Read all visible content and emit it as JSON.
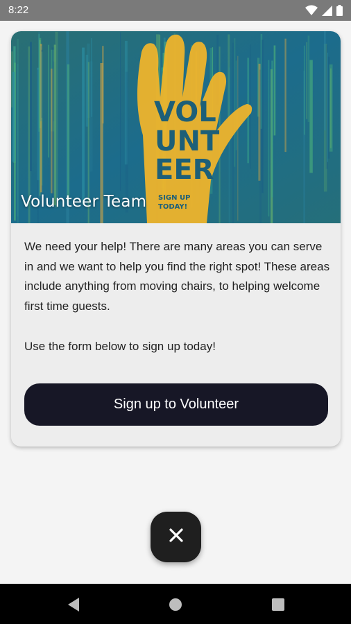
{
  "status": {
    "time": "8:22",
    "icons": [
      "wifi-icon",
      "signal-icon",
      "battery-icon"
    ]
  },
  "card": {
    "banner": {
      "title": "Volunteer Team",
      "image_text": [
        "VOL",
        "UNT",
        "EER",
        "SIGN UP",
        "TODAY!"
      ],
      "colors": {
        "background": "#1f6f86",
        "hand": "#f2b52a"
      }
    },
    "description": "We need your help! There are many areas you can serve in and we want to help you find the right spot! These areas include anything from moving chairs, to helping welcome first time guests.",
    "description_2": "Use the form below to sign up today!",
    "button_label": "Sign up to Volunteer"
  },
  "fab": {
    "icon": "close-icon"
  },
  "nav": {
    "icons": [
      "back-icon",
      "home-icon",
      "recents-icon"
    ]
  },
  "colors": {
    "button": "#171726",
    "status_bar": "#7a7a7a"
  }
}
